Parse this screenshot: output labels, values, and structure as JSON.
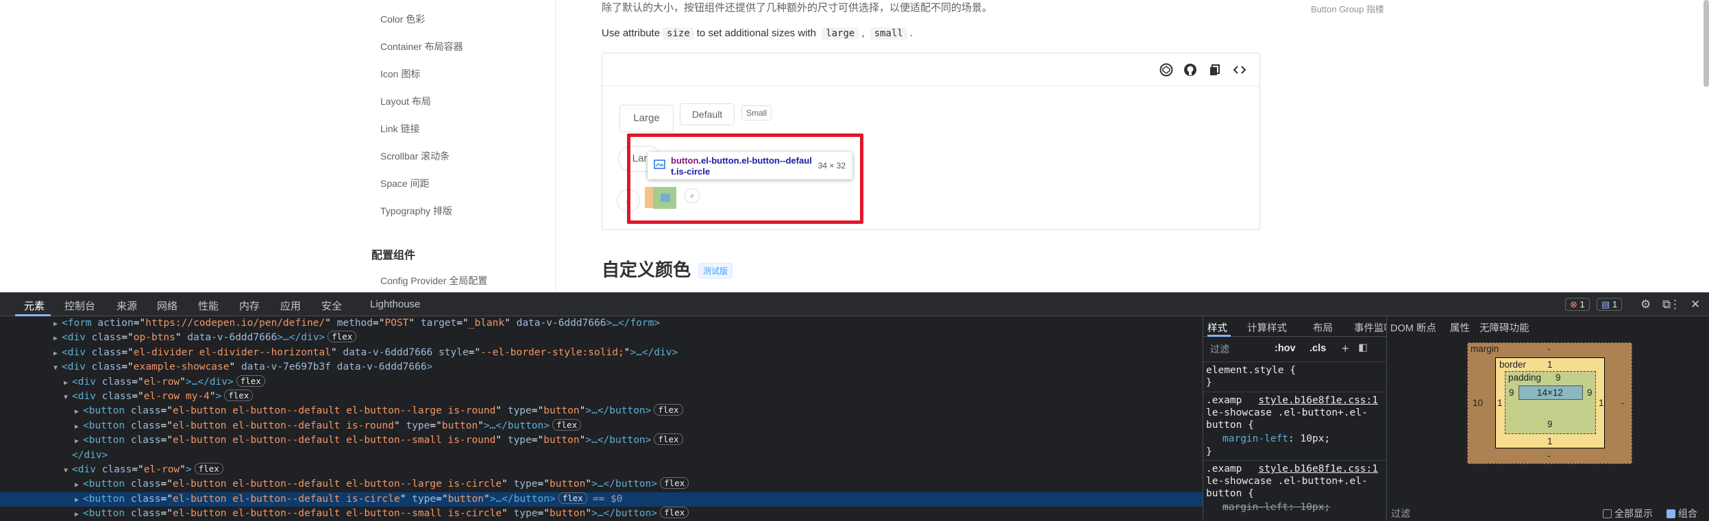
{
  "sidebar": {
    "items": [
      "Color 色彩",
      "Container 布局容器",
      "Icon 图标",
      "Layout 布局",
      "Link 链接",
      "Scrollbar 滚动条",
      "Space 间距",
      "Typography 排版"
    ],
    "category": "配置组件",
    "category_items": [
      "Config Provider 全局配置"
    ]
  },
  "content": {
    "intro_cn": "除了默认的大小，按钮组件还提供了几种额外的尺寸可供选择，以便适配不同的场景。",
    "toc_item": "Button Group 指楼",
    "attr_pre": "Use attribute",
    "attr_code": "size",
    "attr_mid": "to set additional sizes with",
    "attr_code2": "large",
    "attr_sep": ",",
    "attr_code3": "small",
    "attr_end": ".",
    "demo": {
      "row1": [
        "Large",
        "Default",
        "Small"
      ],
      "row2_visible": "Lar"
    },
    "tooltip": {
      "tag": "button",
      "classes": ".el-button.el-button--default.is-circle",
      "size": "34 × 32"
    },
    "heading": "自定义颜色",
    "beta_badge": "测试版"
  },
  "devtools": {
    "tabs": [
      "元素",
      "控制台",
      "来源",
      "网络",
      "性能",
      "内存",
      "应用",
      "安全",
      "Lighthouse"
    ],
    "badges": {
      "errors": "1",
      "messages": "1"
    },
    "tree": [
      {
        "indent": 0,
        "tri": "▶",
        "html": "form",
        "attrs": [
          [
            "action",
            "https://codepen.io/pen/define/"
          ],
          [
            "method",
            "POST"
          ],
          [
            "target",
            "_blank"
          ],
          [
            "data-v-6ddd7666",
            ""
          ]
        ],
        "tail": ">…</form>",
        "pill": ""
      },
      {
        "indent": 0,
        "tri": "▶",
        "html": "div",
        "attrs": [
          [
            "class",
            "op-btns"
          ],
          [
            "data-v-6ddd7666",
            ""
          ]
        ],
        "tail": ">…</div>",
        "pill": "flex"
      },
      {
        "indent": 0,
        "tri": "▶",
        "html": "div",
        "attrs": [
          [
            "class",
            "el-divider el-divider--horizontal"
          ],
          [
            "data-v-6ddd7666",
            ""
          ],
          [
            "style",
            "--el-border-style:solid;"
          ]
        ],
        "tail": ">…</div>",
        "pill": ""
      },
      {
        "indent": 0,
        "tri": "▼",
        "html": "div",
        "attrs": [
          [
            "class",
            "example-showcase"
          ],
          [
            "data-v-7e697b3f",
            ""
          ],
          [
            "data-v-6ddd7666",
            ""
          ]
        ],
        "tail": ">",
        "pill": ""
      },
      {
        "indent": 1,
        "tri": "▶",
        "html": "div",
        "attrs": [
          [
            "class",
            "el-row"
          ]
        ],
        "tail": ">…</div>",
        "pill": "flex"
      },
      {
        "indent": 1,
        "tri": "▼",
        "html": "div",
        "attrs": [
          [
            "class",
            "el-row my-4"
          ]
        ],
        "tail": ">",
        "pill": "flex"
      },
      {
        "indent": 2,
        "tri": "▶",
        "html": "button",
        "attrs": [
          [
            "class",
            "el-button el-button--default el-button--large is-round"
          ],
          [
            "type",
            "button"
          ]
        ],
        "tail": ">…</button>",
        "pill": "flex"
      },
      {
        "indent": 2,
        "tri": "▶",
        "html": "button",
        "attrs": [
          [
            "class",
            "el-button el-button--default is-round"
          ],
          [
            "type",
            "button"
          ]
        ],
        "tail": ">…</button>",
        "pill": "flex"
      },
      {
        "indent": 2,
        "tri": "▶",
        "html": "button",
        "attrs": [
          [
            "class",
            "el-button el-button--default el-button--small is-round"
          ],
          [
            "type",
            "button"
          ]
        ],
        "tail": ">…</button>",
        "pill": "flex"
      },
      {
        "indent": 1,
        "tri": "",
        "html": "",
        "attrs": [],
        "tail": "</div>",
        "pill": ""
      },
      {
        "indent": 1,
        "tri": "▼",
        "html": "div",
        "attrs": [
          [
            "class",
            "el-row"
          ]
        ],
        "tail": ">",
        "pill": "flex"
      },
      {
        "indent": 2,
        "tri": "▶",
        "html": "button",
        "attrs": [
          [
            "class",
            "el-button el-button--default el-button--large is-circle"
          ],
          [
            "type",
            "button"
          ]
        ],
        "tail": ">…</button>",
        "pill": "flex"
      },
      {
        "indent": 2,
        "tri": "▶",
        "html": "button",
        "attrs": [
          [
            "class",
            "el-button el-button--default is-circle"
          ],
          [
            "type",
            "button"
          ]
        ],
        "tail": ">…</button>",
        "pill": "flex",
        "selected": true,
        "eq": "== $0"
      },
      {
        "indent": 2,
        "tri": "▶",
        "html": "button",
        "attrs": [
          [
            "class",
            "el-button el-button--default el-button--small is-circle"
          ],
          [
            "type",
            "button"
          ]
        ],
        "tail": ">…</button>",
        "pill": "flex"
      }
    ],
    "styles": {
      "tabs": [
        "样式",
        "计算样式",
        "布局",
        "事件监听器",
        "DOM 断点",
        "属性",
        "无障碍功能"
      ],
      "filter_placeholder": "过滤",
      "hov": ":hov",
      "cls": ".cls",
      "element_style": "element.style {",
      "close": "}",
      "rule1_sel": [
        ".examp",
        "le-showcase .el-button+.el-",
        "button {"
      ],
      "rule1_src": "style.b16e8f1e.css:1",
      "rule1_prop": "margin-left",
      "rule1_val": "10px;",
      "rule2_sel": [
        ".examp",
        "le-showcase .el-button+.el-",
        "button {"
      ],
      "rule2_src": "style.b16e8f1e.css:1",
      "rule2_prop": "margin-left",
      "rule2_val": "10px;"
    },
    "boxmodel": {
      "margin_label": "margin",
      "margin_top": "-",
      "margin_left": "10",
      "margin_right": "-",
      "margin_bottom": "-",
      "border_label": "border",
      "border_top": "1",
      "border_left": "1",
      "border_right": "1",
      "border_bottom": "1",
      "padding_label": "padding",
      "padding_top": "9",
      "padding_left": "9",
      "padding_right": "9",
      "padding_bottom": "9",
      "content": "14×12",
      "filter": "过滤",
      "show_all": "全部显示",
      "group": "组合"
    }
  }
}
